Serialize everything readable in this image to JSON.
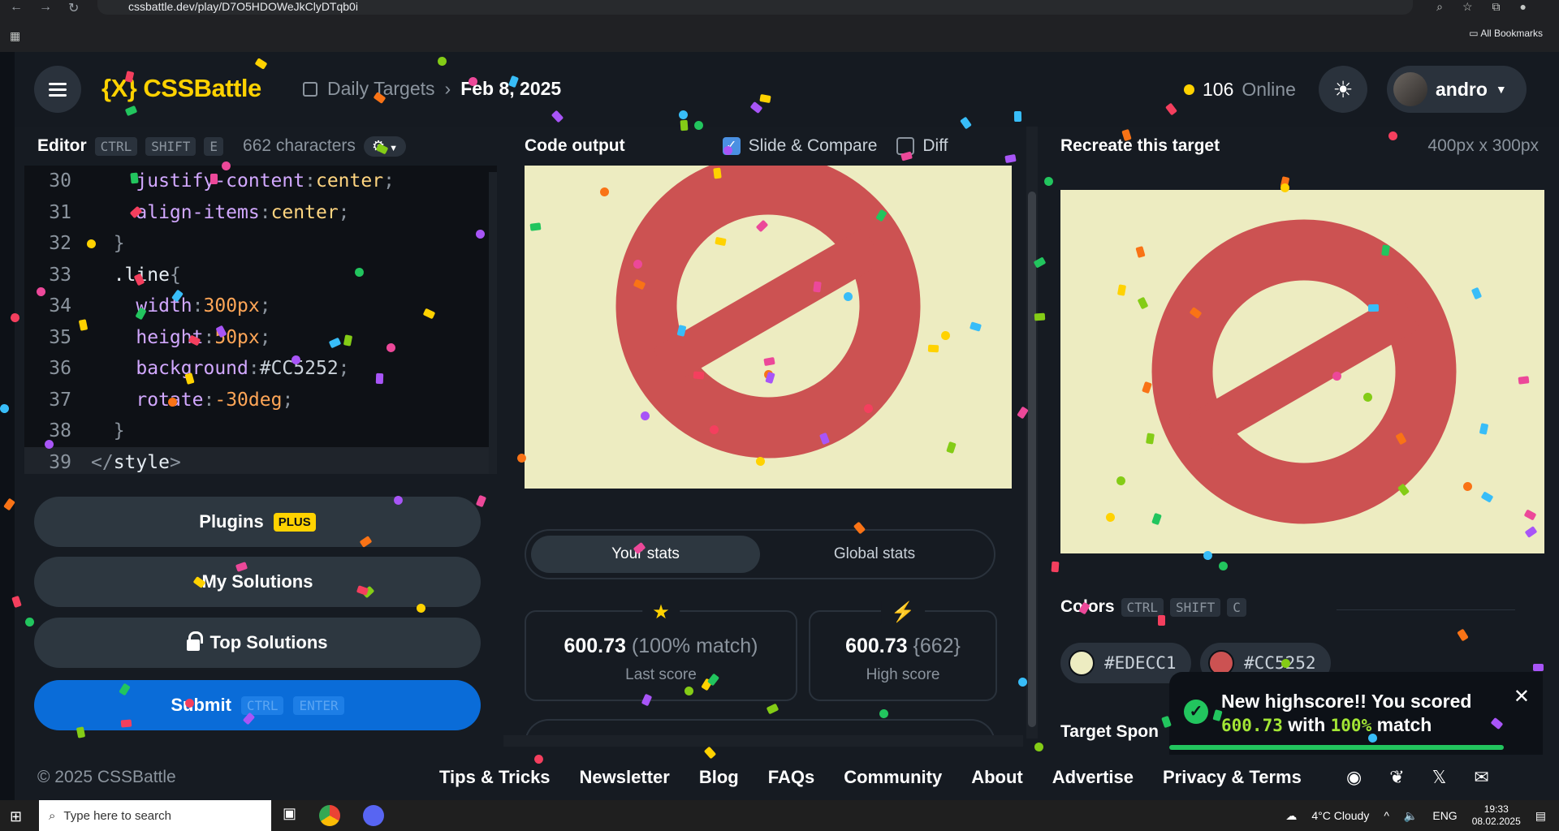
{
  "browser": {
    "url": "cssbattle.dev/play/D7O5HDOWeJkClyDTqb0i",
    "bookmarks_label": "All Bookmarks"
  },
  "header": {
    "logo": "{X} CSSBattle",
    "breadcrumb_section": "Daily Targets",
    "breadcrumb_date": "Feb 8, 2025",
    "online_count": "106",
    "online_label": "Online",
    "username": "andro"
  },
  "editor": {
    "title": "Editor",
    "shortcut_keys": [
      "CTRL",
      "SHIFT",
      "E"
    ],
    "char_count": "662 characters",
    "lines": [
      {
        "n": "30",
        "text": "    justify-content:center;"
      },
      {
        "n": "31",
        "text": "    align-items:center;"
      },
      {
        "n": "32",
        "text": "  }"
      },
      {
        "n": "33",
        "text": "  .line{"
      },
      {
        "n": "34",
        "text": "    width:300px;"
      },
      {
        "n": "35",
        "text": "    height:50px;"
      },
      {
        "n": "36",
        "text": "    background:#CC5252;"
      },
      {
        "n": "37",
        "text": "    rotate:-30deg;"
      },
      {
        "n": "38",
        "text": "  }"
      },
      {
        "n": "39",
        "text": "</style>"
      }
    ]
  },
  "sidebar_buttons": {
    "plugins": "Plugins",
    "plugins_badge": "PLUS",
    "my_solutions": "My Solutions",
    "top_solutions": "Top Solutions",
    "submit": "Submit",
    "submit_keys": [
      "CTRL",
      "ENTER"
    ]
  },
  "output": {
    "title": "Code output",
    "slide_compare": "Slide & Compare",
    "diff": "Diff",
    "tab_your_stats": "Your stats",
    "tab_global_stats": "Global stats",
    "last_score_value": "600.73",
    "last_score_match": "(100% match)",
    "last_score_label": "Last score",
    "high_score_value": "600.73",
    "high_score_chars": "{662}",
    "high_score_label": "High score"
  },
  "target": {
    "title": "Recreate this target",
    "size": "400px x 300px",
    "colors_label": "Colors",
    "colors_keys": [
      "CTRL",
      "SHIFT",
      "C"
    ],
    "color_1": "#EDECC1",
    "color_2": "#CC5252",
    "sponsor_label": "Target Spon"
  },
  "toast": {
    "line1": "New highscore!! You scored",
    "score": "600.73",
    "with": "with",
    "match": "100%",
    "match_suffix": "match"
  },
  "footer": {
    "copyright": "© 2025 CSSBattle",
    "links": [
      "Tips & Tricks",
      "Newsletter",
      "Blog",
      "FAQs",
      "Community",
      "About",
      "Advertise",
      "Privacy & Terms"
    ]
  },
  "taskbar": {
    "search_placeholder": "Type here to search",
    "weather": "4°C  Cloudy",
    "lang": "ENG",
    "time": "19:33",
    "date": "08.02.2025"
  },
  "colors": {
    "bg": "#EDECC1",
    "red": "#CC5252",
    "accent_yellow": "#FFD200",
    "submit_blue": "#0A6CD8",
    "success_green": "#22C55E"
  }
}
